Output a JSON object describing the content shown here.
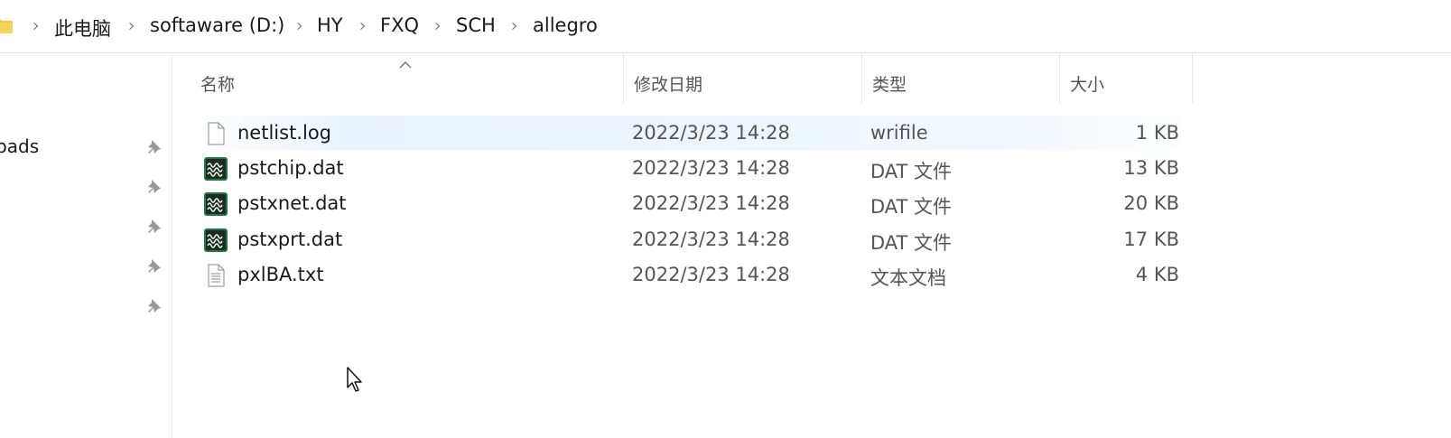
{
  "breadcrumb": [
    "此电脑",
    "softaware (D:)",
    "HY",
    "FXQ",
    "SCH",
    "allegro"
  ],
  "nav": {
    "partial_label": "loads",
    "pins": 5
  },
  "columns": {
    "name": "名称",
    "date": "修改日期",
    "type": "类型",
    "size": "大小"
  },
  "files": [
    {
      "name": "netlist.log",
      "date": "2022/3/23 14:28",
      "type": "wrifile",
      "size": "1 KB",
      "icon": "blank-file-icon",
      "selected": true
    },
    {
      "name": "pstchip.dat",
      "date": "2022/3/23 14:28",
      "type": "DAT 文件",
      "size": "13 KB",
      "icon": "waveform-file-icon",
      "selected": false
    },
    {
      "name": "pstxnet.dat",
      "date": "2022/3/23 14:28",
      "type": "DAT 文件",
      "size": "20 KB",
      "icon": "waveform-file-icon",
      "selected": false
    },
    {
      "name": "pstxprt.dat",
      "date": "2022/3/23 14:28",
      "type": "DAT 文件",
      "size": "17 KB",
      "icon": "waveform-file-icon",
      "selected": false
    },
    {
      "name": "pxlBA.txt",
      "date": "2022/3/23 14:28",
      "type": "文本文档",
      "size": "4 KB",
      "icon": "text-file-icon",
      "selected": false
    }
  ],
  "colors": {
    "selection": "#eef6fe",
    "folder": "#f4c74a",
    "dat_icon": "#1f7a3f"
  }
}
